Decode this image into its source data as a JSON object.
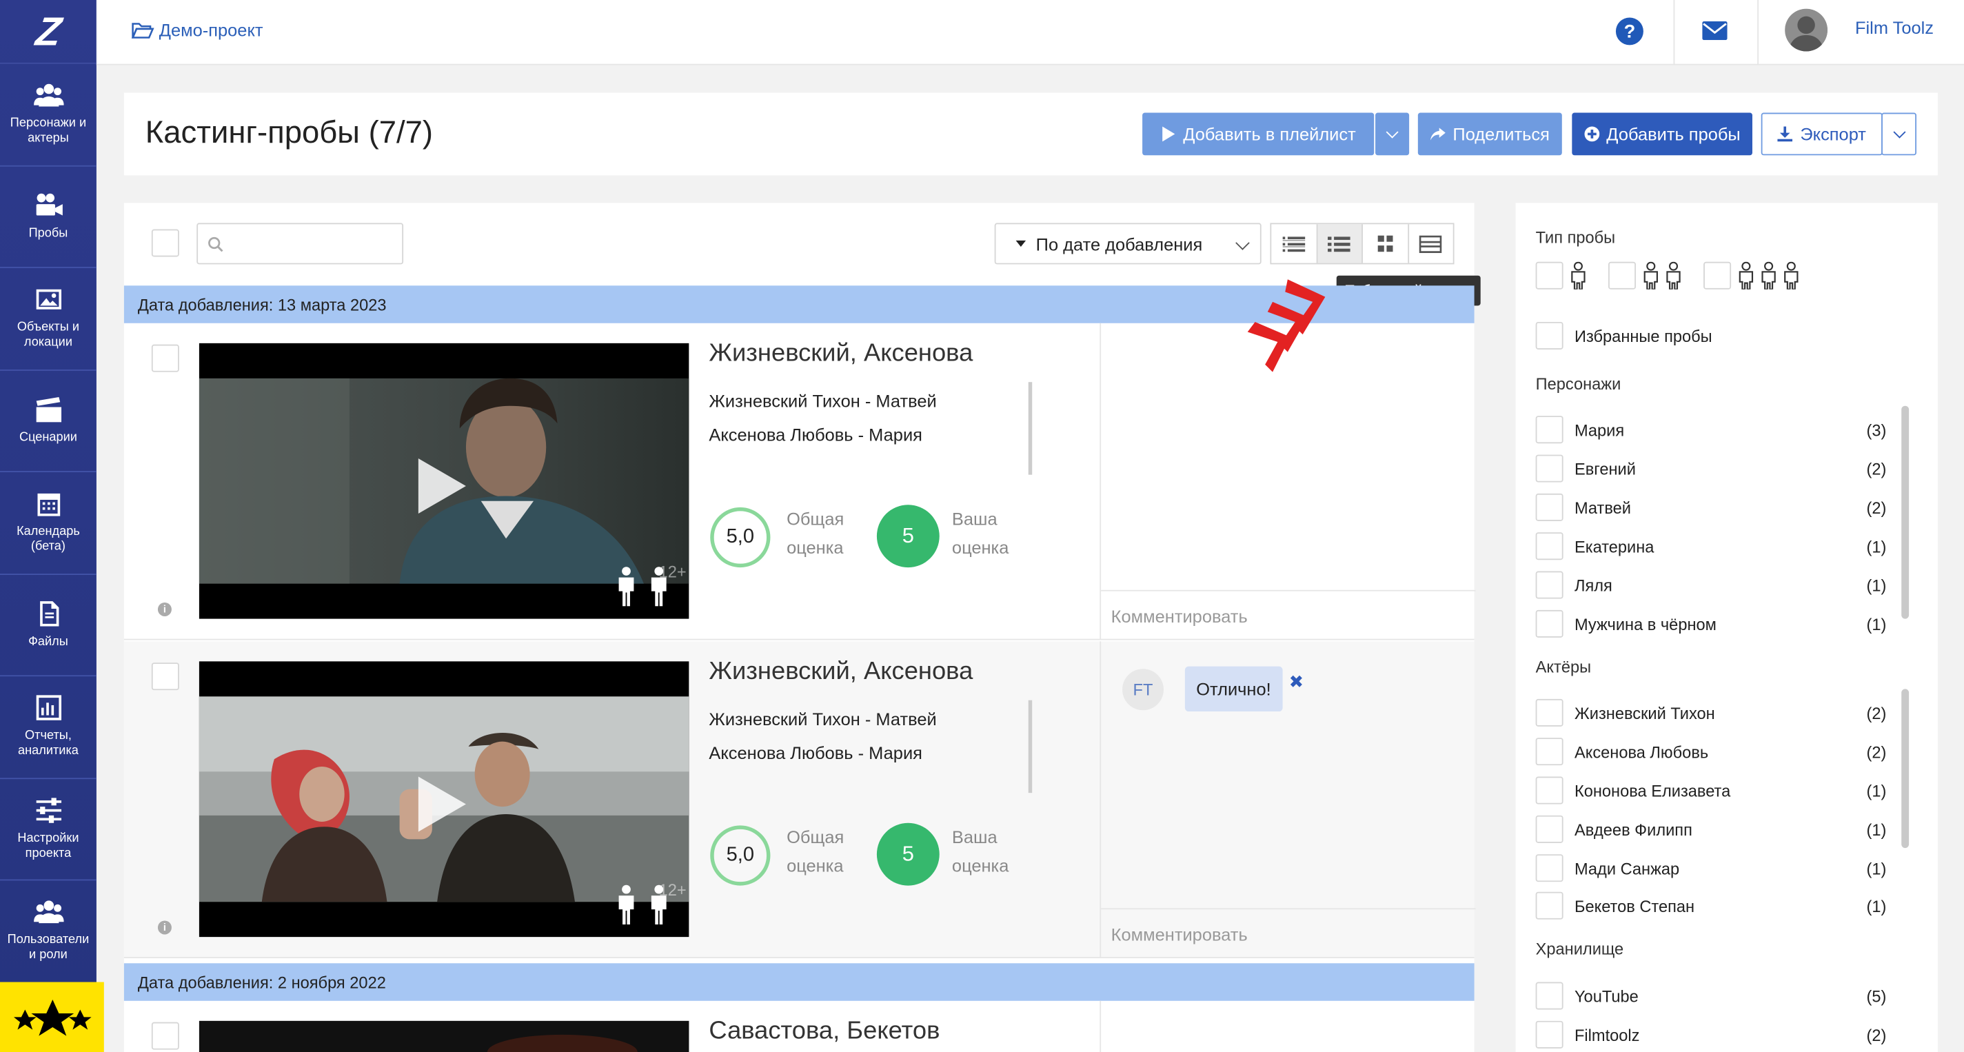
{
  "sidebar": {
    "logo": "Z",
    "items": [
      {
        "label": "Персонажи и актеры",
        "icon": "users-icon"
      },
      {
        "label": "Пробы",
        "icon": "video-camera-icon"
      },
      {
        "label": "Объекты и локации",
        "icon": "image-icon"
      },
      {
        "label": "Сценарии",
        "icon": "clapperboard-icon"
      },
      {
        "label": "Календарь (бета)",
        "icon": "calendar-icon"
      },
      {
        "label": "Файлы",
        "icon": "file-icon"
      },
      {
        "label": "Отчеты, аналитика",
        "icon": "bar-chart-icon"
      },
      {
        "label": "Настройки проекта",
        "icon": "sliders-icon"
      },
      {
        "label": "Пользователи и роли",
        "icon": "user-group-icon"
      }
    ],
    "bottom_color": "#ffe300"
  },
  "topbar": {
    "breadcrumb": "Демо-проект",
    "help": "?",
    "user_name": "Film Toolz"
  },
  "header": {
    "title": "Кастинг-пробы (7/7)",
    "add_playlist": "Добавить в плейлист",
    "share": "Поделиться",
    "add_trials": "Добавить пробы",
    "export": "Экспорт"
  },
  "toolbar": {
    "search_placeholder": "",
    "sort_label": "По дате добавления",
    "tooltip": "Табличный режим"
  },
  "groups": [
    {
      "label": "Дата добавления: 13 марта 2023"
    },
    {
      "label": "Дата добавления: 2 ноября 2022"
    }
  ],
  "rows": [
    {
      "title": "Жизневский, Аксенова",
      "roles": [
        "Жизневский Тихон - Матвей",
        "Аксенова Любовь - Мария"
      ],
      "overall_score": "5,0",
      "overall_label_1": "Общая",
      "overall_label_2": "оценка",
      "your_score": "5",
      "your_label_1": "Ваша",
      "your_label_2": "оценка",
      "age": "12+",
      "comment_placeholder": "Комментировать",
      "comments": []
    },
    {
      "title": "Жизневский, Аксенова",
      "roles": [
        "Жизневский Тихон - Матвей",
        "Аксенова Любовь - Мария"
      ],
      "overall_score": "5,0",
      "overall_label_1": "Общая",
      "overall_label_2": "оценка",
      "your_score": "5",
      "your_label_1": "Ваша",
      "your_label_2": "оценка",
      "age": "12+",
      "comment_placeholder": "Комментировать",
      "comments": [
        {
          "author": "FT",
          "text": "Отлично!",
          "delete": "✖"
        }
      ]
    },
    {
      "title": "Савастова, Бекетов"
    }
  ],
  "filters": {
    "type_heading": "Тип пробы",
    "favorites": "Избранные пробы",
    "characters_heading": "Персонажи",
    "characters": [
      {
        "name": "Мария",
        "count": "(3)"
      },
      {
        "name": "Евгений",
        "count": "(2)"
      },
      {
        "name": "Матвей",
        "count": "(2)"
      },
      {
        "name": "Екатерина",
        "count": "(1)"
      },
      {
        "name": "Ляля",
        "count": "(1)"
      },
      {
        "name": "Мужчина в чёрном",
        "count": "(1)"
      }
    ],
    "actors_heading": "Актёры",
    "actors": [
      {
        "name": "Жизневский Тихон",
        "count": "(2)"
      },
      {
        "name": "Аксенова Любовь",
        "count": "(2)"
      },
      {
        "name": "Кононова Елизавета",
        "count": "(1)"
      },
      {
        "name": "Авдеев Филипп",
        "count": "(1)"
      },
      {
        "name": "Мади Санжар",
        "count": "(1)"
      },
      {
        "name": "Бекетов Степан",
        "count": "(1)"
      }
    ],
    "storage_heading": "Хранилище",
    "storage": [
      {
        "name": "YouTube",
        "count": "(5)"
      },
      {
        "name": "Filmtoolz",
        "count": "(2)"
      }
    ]
  },
  "colors": {
    "sidebar": "#2d3a8c",
    "group_header": "#a6c6f3",
    "primary_button": "#2e5bbb",
    "light_button": "#6f9be0",
    "score_green": "#36b86d"
  }
}
